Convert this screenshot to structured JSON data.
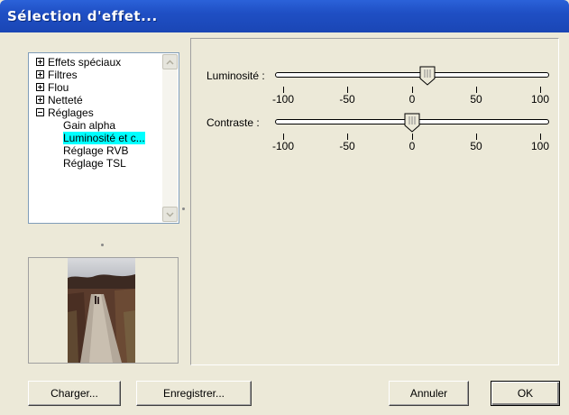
{
  "window": {
    "title": "Sélection d'effet..."
  },
  "tree": {
    "items": [
      {
        "label": "Effets spéciaux",
        "expander": "plus"
      },
      {
        "label": "Filtres",
        "expander": "plus"
      },
      {
        "label": "Flou",
        "expander": "plus"
      },
      {
        "label": "Netteté",
        "expander": "plus"
      },
      {
        "label": "Réglages",
        "expander": "minus"
      }
    ],
    "children": [
      {
        "label": "Gain alpha",
        "selected": false
      },
      {
        "label": "Luminosité et c...",
        "selected": true
      },
      {
        "label": "Réglage RVB",
        "selected": false
      },
      {
        "label": "Réglage TSL",
        "selected": false
      }
    ]
  },
  "sliders": {
    "brightness": {
      "label": "Luminosité :",
      "value": 12,
      "min": -100,
      "max": 100
    },
    "contrast": {
      "label": "Contraste :",
      "value": 0,
      "min": -100,
      "max": 100
    },
    "ticks": [
      "-100",
      "-50",
      "0",
      "50",
      "100"
    ]
  },
  "buttons": {
    "load": "Charger...",
    "save": "Enregistrer...",
    "cancel": "Annuler",
    "ok": "OK"
  },
  "colors": {
    "titlebar": "#1f4fc4",
    "dialog_bg": "#ece9d8",
    "selection": "#00ffff"
  }
}
